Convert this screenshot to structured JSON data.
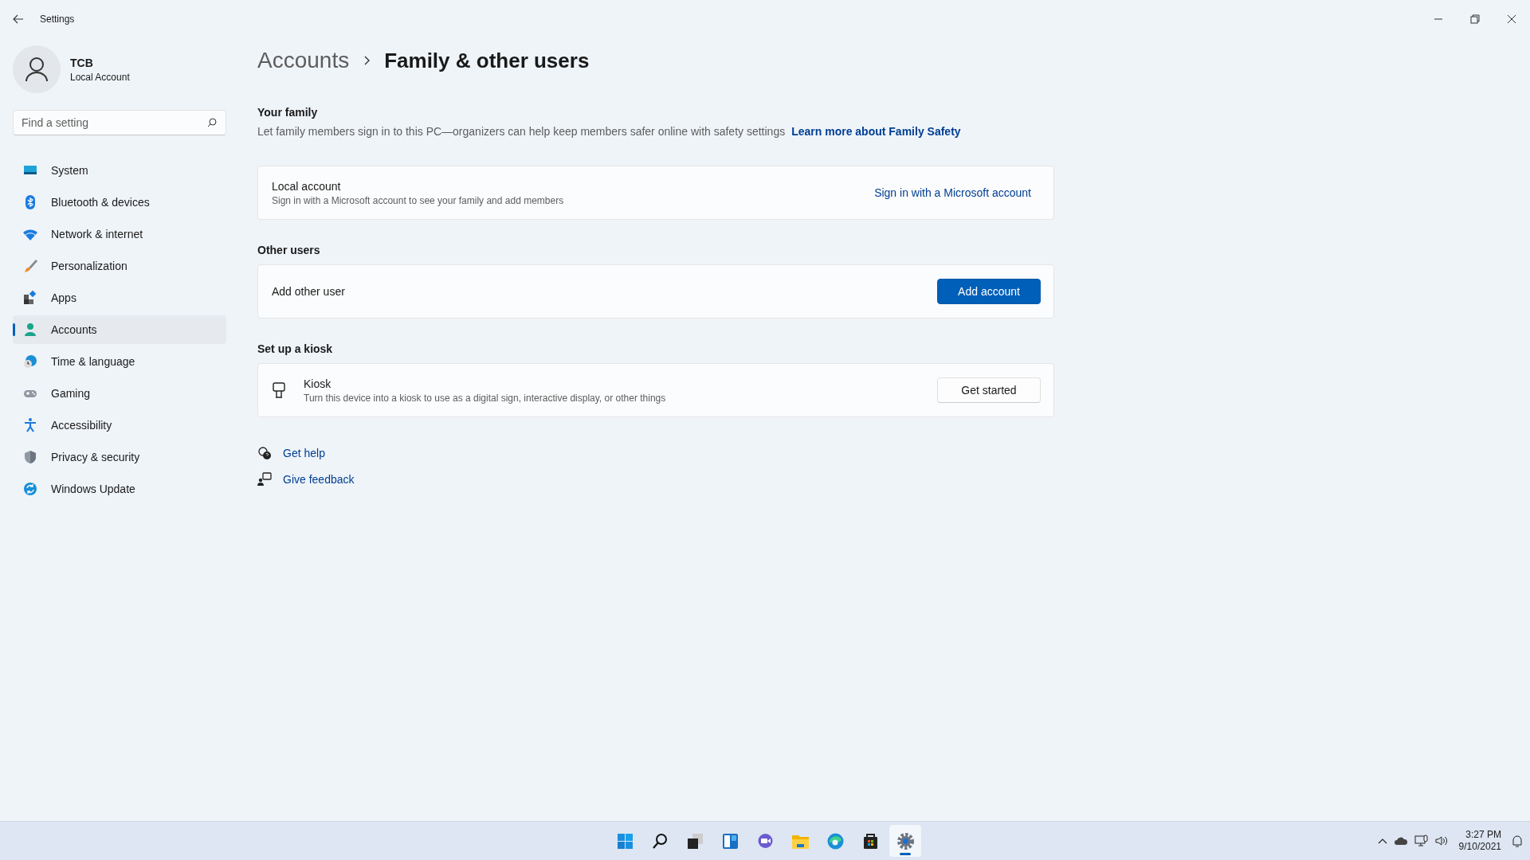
{
  "window": {
    "title": "Settings"
  },
  "user": {
    "name": "TCB",
    "account_type": "Local Account"
  },
  "search": {
    "placeholder": "Find a setting"
  },
  "nav": [
    {
      "label": "System",
      "selected": false
    },
    {
      "label": "Bluetooth & devices",
      "selected": false
    },
    {
      "label": "Network & internet",
      "selected": false
    },
    {
      "label": "Personalization",
      "selected": false
    },
    {
      "label": "Apps",
      "selected": false
    },
    {
      "label": "Accounts",
      "selected": true
    },
    {
      "label": "Time & language",
      "selected": false
    },
    {
      "label": "Gaming",
      "selected": false
    },
    {
      "label": "Accessibility",
      "selected": false
    },
    {
      "label": "Privacy & security",
      "selected": false
    },
    {
      "label": "Windows Update",
      "selected": false
    }
  ],
  "breadcrumb": {
    "parent": "Accounts",
    "current": "Family & other users"
  },
  "sections": [
    {
      "heading": "Your family",
      "description": "Let family members sign in to this PC—organizers can help keep members safer online with safety settings",
      "link": "Learn more about Family Safety",
      "card": {
        "kind": "plain",
        "title": "Local account",
        "subtitle": "Sign in with a Microsoft account to see your family and add members",
        "action": {
          "kind": "link",
          "label": "Sign in with a Microsoft account"
        }
      }
    },
    {
      "heading": "Other users",
      "card": {
        "kind": "plain",
        "title": "Add other user",
        "action": {
          "kind": "primary",
          "label": "Add account"
        }
      }
    },
    {
      "heading": "Set up a kiosk",
      "card": {
        "kind": "kiosk",
        "title": "Kiosk",
        "subtitle": "Turn this device into a kiosk to use as a digital sign, interactive display, or other things",
        "action": {
          "kind": "secondary",
          "label": "Get started"
        }
      }
    }
  ],
  "help_links": [
    {
      "label": "Get help"
    },
    {
      "label": "Give feedback"
    }
  ],
  "taskbar": {
    "apps": [
      {
        "selected": false
      },
      {
        "selected": false
      },
      {
        "selected": false
      },
      {
        "selected": false
      },
      {
        "selected": false
      },
      {
        "selected": false
      },
      {
        "selected": false
      },
      {
        "selected": false
      },
      {
        "selected": true
      }
    ]
  },
  "tray": {
    "time": "3:27 PM",
    "date": "9/10/2021"
  }
}
